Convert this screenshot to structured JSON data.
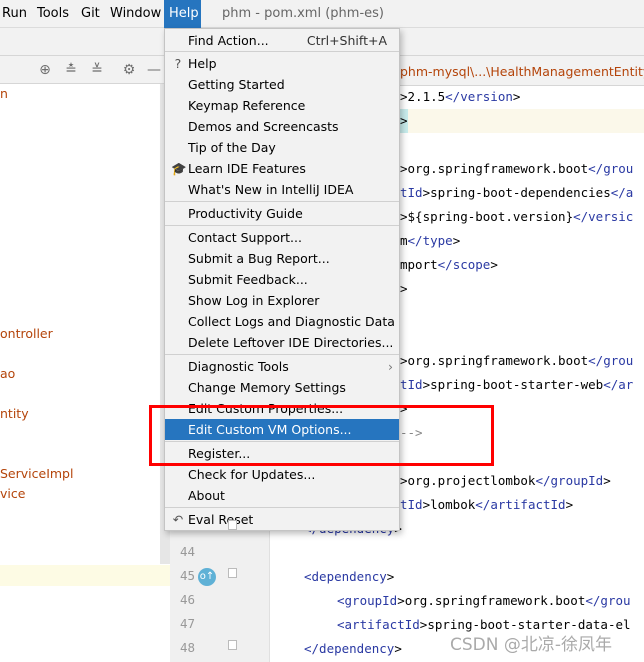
{
  "menubar": {
    "items": [
      "Run",
      "Tools",
      "Git",
      "Window",
      "Help"
    ],
    "active": "Help"
  },
  "window_title": "phm - pom.xml (phm-es)",
  "editor_tab_path": "phm-mysql\\...\\HealthManagementEntity.jav",
  "project_tree": {
    "items": [
      "n",
      "ontroller",
      "ao",
      "ntity",
      "ServiceImpl",
      "vice"
    ]
  },
  "gutter": {
    "line_numbers": [
      "44",
      "45",
      "46",
      "47",
      "48"
    ]
  },
  "code_lines": [
    [
      ">2.1.5",
      "</version",
      ">"
    ],
    [
      ">"
    ],
    [
      ""
    ],
    [
      ">org.springframework.boot",
      "</grou"
    ],
    [
      "tId",
      ">spring-boot-dependencies",
      "</a"
    ],
    [
      ">${spring-boot.version}",
      "</versic"
    ],
    [
      "m",
      "</type",
      ">"
    ],
    [
      "mport",
      "</scope",
      ">"
    ],
    [
      ">"
    ],
    [
      ""
    ],
    [
      ""
    ],
    [
      ">org.springframework.boot",
      "</grou"
    ],
    [
      "tId",
      ">spring-boot-starter-web",
      "</ar"
    ],
    [
      ">"
    ],
    [
      "-->"
    ],
    [
      ""
    ],
    [
      ">org.projectlombok",
      "</groupId",
      ">"
    ],
    [
      "tId",
      ">lombok",
      "</artifactId",
      ">"
    ],
    [
      "</dependency",
      ">"
    ],
    [
      ""
    ],
    [
      "<dependency",
      ">"
    ],
    [
      "<groupId",
      ">org.springframework.boot",
      "</grou"
    ],
    [
      "<artifactId",
      ">spring-boot-starter-data-el"
    ],
    [
      "</dependency",
      ">"
    ]
  ],
  "help_menu": {
    "items": [
      {
        "label": "Find Action...",
        "shortcut": "Ctrl+Shift+A"
      },
      {
        "label": "Help",
        "icon": "question-icon"
      },
      {
        "label": "Getting Started"
      },
      {
        "label": "Keymap Reference"
      },
      {
        "label": "Demos and Screencasts"
      },
      {
        "label": "Tip of the Day"
      },
      {
        "label": "Learn IDE Features",
        "icon": "graduation-cap-icon"
      },
      {
        "label": "What's New in IntelliJ IDEA"
      },
      {
        "label": "Productivity Guide"
      },
      {
        "label": "Contact Support..."
      },
      {
        "label": "Submit a Bug Report..."
      },
      {
        "label": "Submit Feedback..."
      },
      {
        "label": "Show Log in Explorer"
      },
      {
        "label": "Collect Logs and Diagnostic Data"
      },
      {
        "label": "Delete Leftover IDE Directories..."
      },
      {
        "label": "Diagnostic Tools",
        "submenu": true
      },
      {
        "label": "Change Memory Settings"
      },
      {
        "label": "Edit Custom Properties..."
      },
      {
        "label": "Edit Custom VM Options...",
        "selected": true
      },
      {
        "label": "Register..."
      },
      {
        "label": "Check for Updates..."
      },
      {
        "label": "About"
      },
      {
        "label": "Eval Reset",
        "icon": "undo-icon"
      }
    ]
  },
  "watermark": "CSDN @北凉-徐凤年",
  "colors": {
    "accent": "#2675bf",
    "highlight_box": "#ff0000",
    "tag": "#2a39a3",
    "path": "#b4440a"
  }
}
